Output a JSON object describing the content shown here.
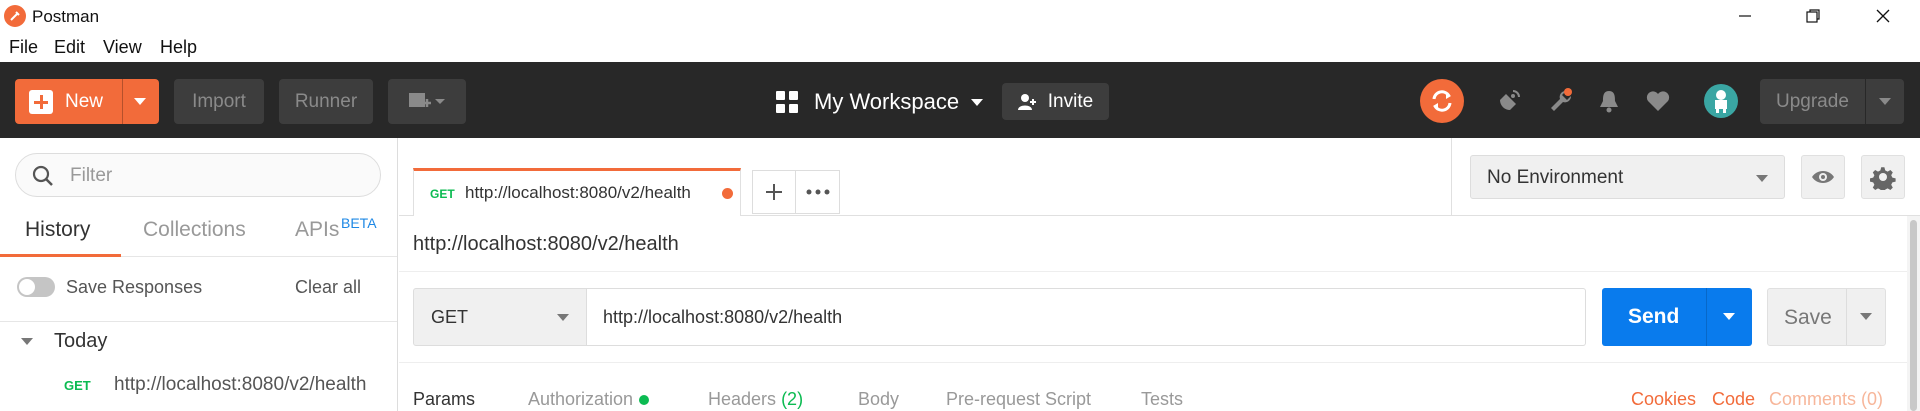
{
  "window": {
    "title": "Postman"
  },
  "menu": [
    "File",
    "Edit",
    "View",
    "Help"
  ],
  "header": {
    "new_label": "New",
    "import_label": "Import",
    "runner_label": "Runner",
    "workspace_label": "My Workspace",
    "invite_label": "Invite",
    "upgrade_label": "Upgrade",
    "accent_color": "#f26b3a"
  },
  "sidebar": {
    "filter_placeholder": "Filter",
    "tabs": [
      "History",
      "Collections",
      "APIs"
    ],
    "beta_label": "BETA",
    "save_responses_label": "Save Responses",
    "clear_all_label": "Clear all",
    "group_label": "Today",
    "history": [
      {
        "method": "GET",
        "url": "http://localhost:8080/v2/health"
      }
    ]
  },
  "tabs": {
    "request_tab": {
      "method": "GET",
      "url": "http://localhost:8080/v2/health"
    }
  },
  "environment": {
    "selected": "No Environment"
  },
  "request": {
    "title": "http://localhost:8080/v2/health",
    "method": "GET",
    "url": "http://localhost:8080/v2/health",
    "send_label": "Send",
    "save_label": "Save",
    "subtabs": {
      "params": "Params",
      "authorization": "Authorization",
      "headers": "Headers",
      "headers_count": "(2)",
      "body": "Body",
      "prerequest": "Pre-request Script",
      "tests": "Tests"
    },
    "links": {
      "cookies": "Cookies",
      "code": "Code",
      "comments": "Comments (0)"
    }
  }
}
